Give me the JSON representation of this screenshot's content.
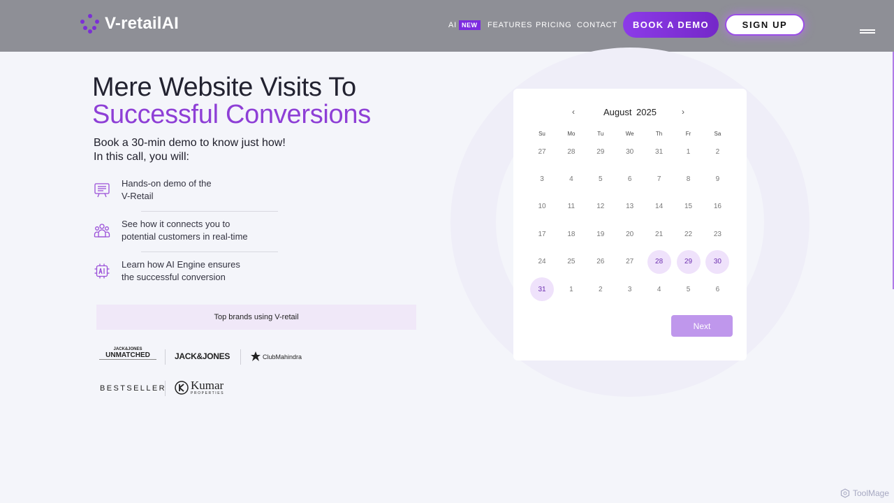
{
  "header": {
    "brand": "V-retailAI",
    "nav": {
      "ai": "AI",
      "new_badge": "NEW",
      "features": "FEATURES",
      "pricing": "PRICING",
      "contact": "CONTACT"
    },
    "book_demo": "BOOK A DEMO",
    "sign_up": "SIGN UP"
  },
  "hero": {
    "title_line1": "Mere Website Visits To",
    "title_line2": "Successful Conversions",
    "sub_line1": "Book a 30-min demo to know just how!",
    "sub_line2": "In this call, you will:"
  },
  "features": [
    {
      "line1": "Hands-on demo of the",
      "line2": "V-Retail"
    },
    {
      "line1": "See how it connects you to",
      "line2": "potential customers in real-time"
    },
    {
      "line1": "Learn how AI Engine ensures",
      "line2": "the successful conversion"
    }
  ],
  "brands": {
    "heading": "Top brands using V-retail",
    "items": [
      "JACK&JONES",
      "UNMATCHED",
      "JACK&JONES",
      "ClubMahindra",
      "BESTSELLER",
      "Kumar",
      "PROPERTIES"
    ]
  },
  "calendar": {
    "prev": "‹",
    "next": "›",
    "month": "August",
    "year": "2025",
    "weekdays": [
      "Su",
      "Mo",
      "Tu",
      "We",
      "Th",
      "Fr",
      "Sa"
    ],
    "weeks": [
      [
        "27",
        "28",
        "29",
        "30",
        "31",
        "1",
        "2"
      ],
      [
        "3",
        "4",
        "5",
        "6",
        "7",
        "8",
        "9"
      ],
      [
        "10",
        "11",
        "12",
        "13",
        "14",
        "15",
        "16"
      ],
      [
        "17",
        "18",
        "19",
        "20",
        "21",
        "22",
        "23"
      ],
      [
        "24",
        "25",
        "26",
        "27",
        "28",
        "29",
        "30"
      ],
      [
        "31",
        "1",
        "2",
        "3",
        "4",
        "5",
        "6"
      ]
    ],
    "highlighted": [
      "4-4",
      "4-5",
      "4-6",
      "5-0"
    ],
    "next_button": "Next"
  },
  "watermark": "ToolMage",
  "colors": {
    "accent": "#8e3fd6",
    "header_bg": "#8e8f96",
    "page_bg": "#f4f5fa"
  }
}
